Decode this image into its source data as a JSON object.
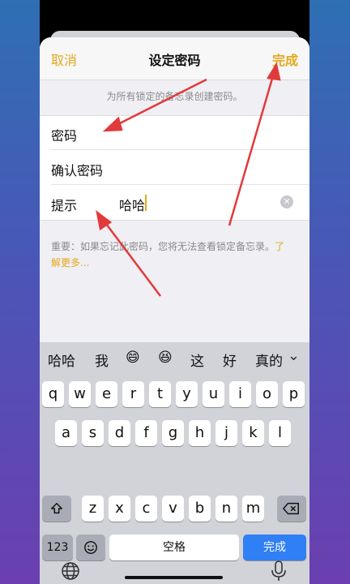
{
  "nav": {
    "cancel": "取消",
    "title": "设定密码",
    "done": "完成"
  },
  "info": "为所有锁定的备忘录创建密码。",
  "fields": [
    {
      "label": "密码",
      "value": ""
    },
    {
      "label": "确认密码",
      "value": ""
    },
    {
      "label": "提示",
      "value": "哈哈"
    }
  ],
  "note": {
    "text": "重要：如果忘记此密码，您将无法查看锁定备忘录。",
    "link": "了解更多..."
  },
  "keyboard": {
    "candidates": [
      "哈哈",
      "我",
      "😄",
      "😆",
      "这",
      "好",
      "真的"
    ],
    "row1": [
      "q",
      "w",
      "e",
      "r",
      "t",
      "y",
      "u",
      "i",
      "o",
      "p"
    ],
    "row2": [
      "a",
      "s",
      "d",
      "f",
      "g",
      "h",
      "j",
      "k",
      "l"
    ],
    "row3": [
      "z",
      "x",
      "c",
      "v",
      "b",
      "n",
      "m"
    ],
    "key_123": "123",
    "space": "空格",
    "return": "完成"
  },
  "colors": {
    "accent": "#e5a81a",
    "blue": "#2f7ff5",
    "arrow": "#e23a3a"
  }
}
